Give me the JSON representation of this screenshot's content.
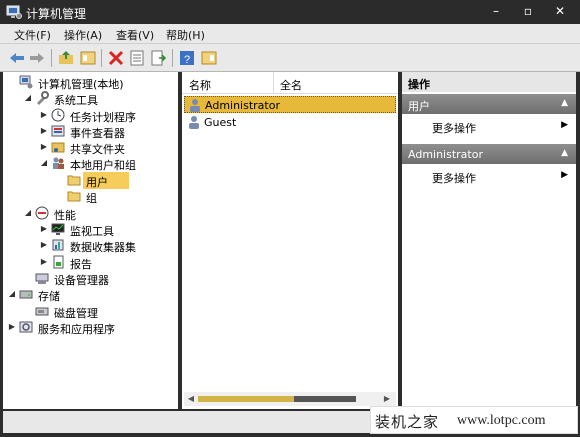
{
  "window": {
    "title": "计算机管理"
  },
  "menu": {
    "items": [
      "文件(F)",
      "操作(A)",
      "查看(V)",
      "帮助(H)"
    ]
  },
  "tree": {
    "items": [
      {
        "label": "计算机管理(本地)",
        "icon": "computer-management-icon",
        "expander": "none"
      },
      {
        "label": "系统工具",
        "icon": "tools-icon",
        "expander": "expanded"
      },
      {
        "label": "任务计划程序",
        "icon": "clock-icon",
        "expander": "collapsed"
      },
      {
        "label": "事件查看器",
        "icon": "event-viewer-icon",
        "expander": "collapsed"
      },
      {
        "label": "共享文件夹",
        "icon": "shared-folder-icon",
        "expander": "collapsed"
      },
      {
        "label": "本地用户和组",
        "icon": "users-group-icon",
        "expander": "expanded"
      },
      {
        "label": "用户",
        "icon": "folder-icon",
        "expander": "none",
        "selected": true
      },
      {
        "label": "组",
        "icon": "folder-icon",
        "expander": "none"
      },
      {
        "label": "性能",
        "icon": "performance-icon",
        "expander": "expanded"
      },
      {
        "label": "监视工具",
        "icon": "monitor-icon",
        "expander": "collapsed"
      },
      {
        "label": "数据收集器集",
        "icon": "data-collector-icon",
        "expander": "collapsed"
      },
      {
        "label": "报告",
        "icon": "report-icon",
        "expander": "collapsed"
      },
      {
        "label": "设备管理器",
        "icon": "device-manager-icon",
        "expander": "none"
      },
      {
        "label": "存储",
        "icon": "storage-icon",
        "expander": "expanded"
      },
      {
        "label": "磁盘管理",
        "icon": "disk-icon",
        "expander": "none"
      },
      {
        "label": "服务和应用程序",
        "icon": "services-icon",
        "expander": "collapsed"
      }
    ]
  },
  "list": {
    "columns": [
      "名称",
      "全名"
    ],
    "rows": [
      {
        "name": "Administrator",
        "icon": "user-icon",
        "selected": true
      },
      {
        "name": "Guest",
        "icon": "user-icon",
        "selected": false
      }
    ]
  },
  "actions": {
    "title": "操作",
    "sections": [
      {
        "label": "用户",
        "item": "更多操作"
      },
      {
        "label": "Administrator",
        "item": "更多操作"
      }
    ]
  },
  "watermark": {
    "cn": "装机之家",
    "url": "www.lotpc.com"
  },
  "colors": {
    "selection": "#e6b93a",
    "tree_selection": "#f6cc5b",
    "section_header": "#7e7e7e"
  }
}
